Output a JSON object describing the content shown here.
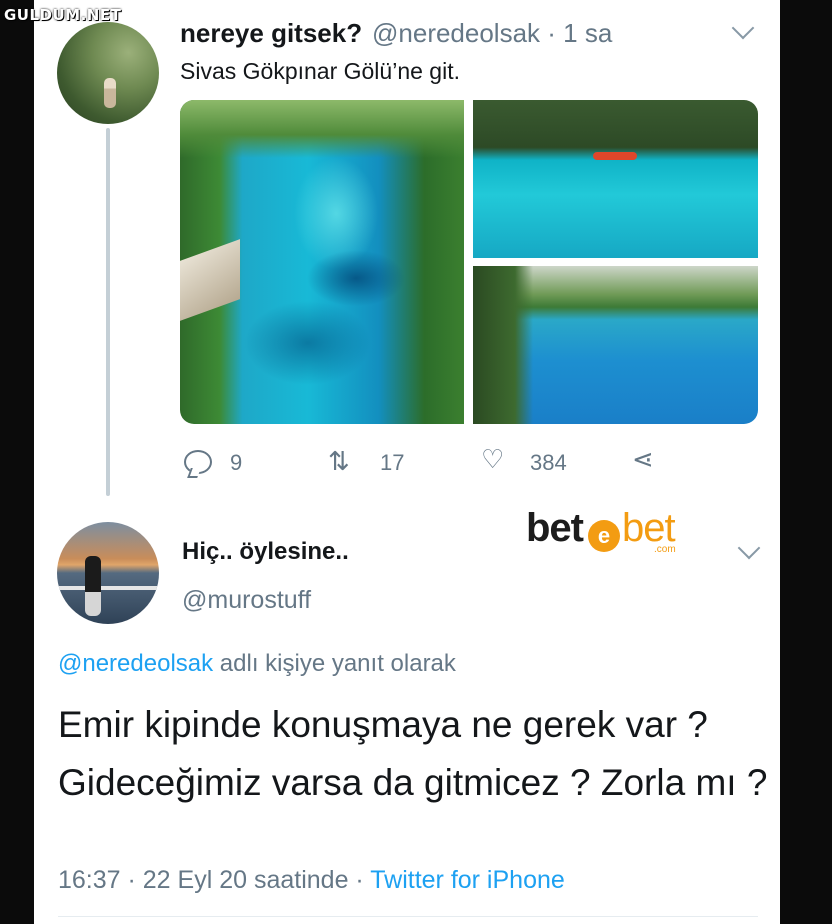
{
  "watermark": "GULDUM.NET",
  "tweet1": {
    "name": "nereye gitsek?",
    "handle": "@neredeolsak · 1 sa",
    "text": "Sivas Gökpınar Gölü’ne git.",
    "reply_count": "9",
    "retweet_count": "17",
    "like_count": "384"
  },
  "tweet2": {
    "name": "Hiç.. öylesine..",
    "handle": "@murostuff",
    "reply_mention": "@neredeolsak",
    "reply_suffix": " adlı kişiye yanıt olarak",
    "text": "Emir kipinde konuşmaya ne gerek var ? Gideceğimiz varsa da gitmicez ? Zorla mı ?",
    "timestamp": "16:37 · 22 Eyl 20 saatinde · ",
    "source": "Twitter for iPhone"
  },
  "logo": {
    "part1": "bet",
    "mark": "e",
    "part2": "bet",
    "suffix": ".com"
  },
  "icons": [
    "chevron-down-icon",
    "reply-icon",
    "retweet-icon",
    "like-icon",
    "share-icon"
  ]
}
